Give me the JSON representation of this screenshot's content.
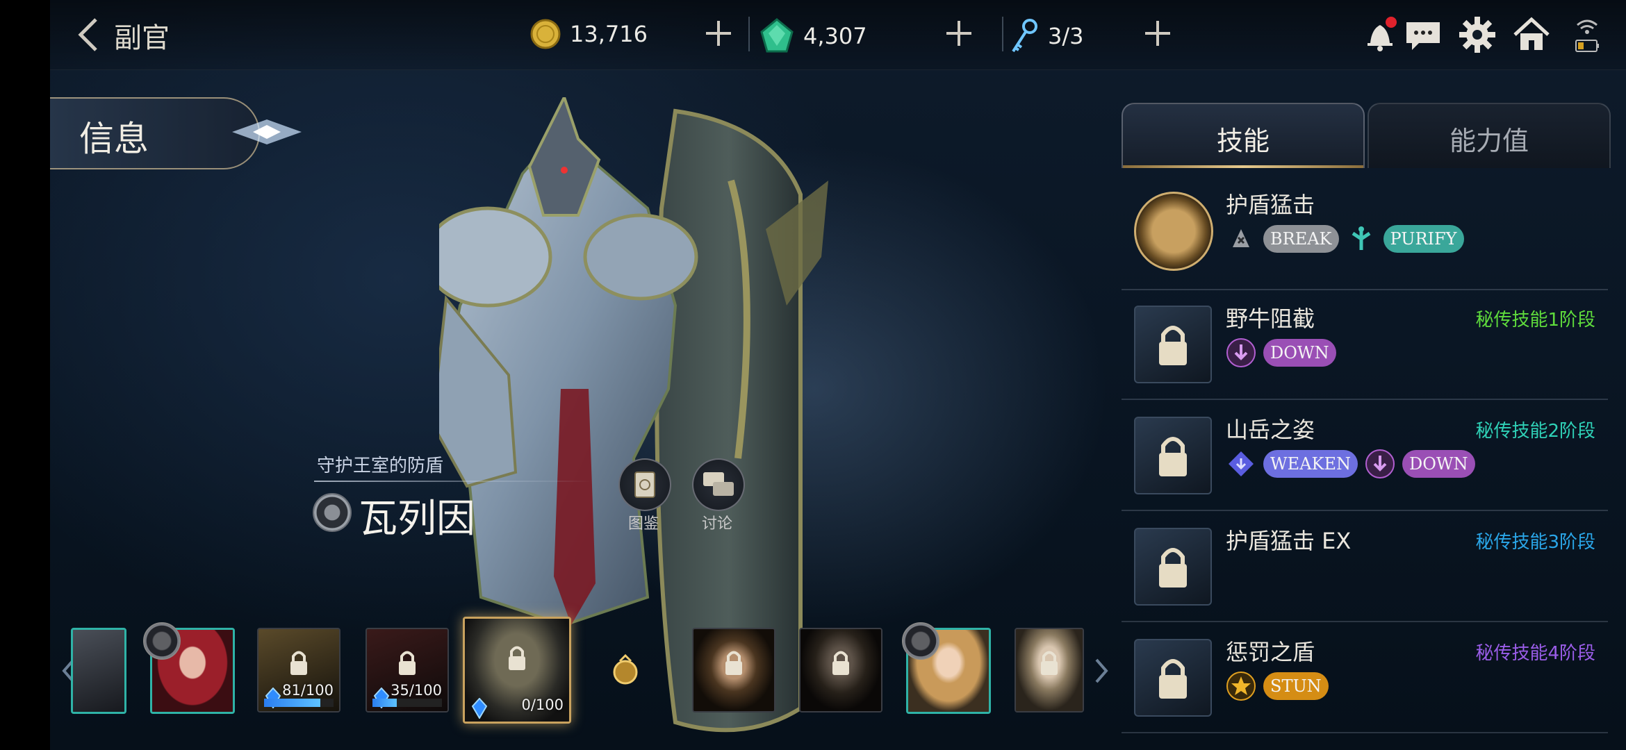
{
  "header": {
    "title": "副官",
    "gold": "13,716",
    "gems": "4,307",
    "keys": "3/3"
  },
  "info_tab": {
    "label": "信息"
  },
  "hero": {
    "subtitle": "守护王室的防盾",
    "name": "瓦列因",
    "btn_codex": "图鉴",
    "btn_discuss": "讨论"
  },
  "roster": [
    {
      "id": "c1",
      "locked": false,
      "teal": true
    },
    {
      "id": "c2",
      "locked": false,
      "teal": true,
      "badge": true
    },
    {
      "id": "c3",
      "locked": true,
      "progress": "81/100",
      "fraction": 0.81
    },
    {
      "id": "c4",
      "locked": true,
      "progress": "35/100",
      "fraction": 0.35
    },
    {
      "id": "c5",
      "locked": true,
      "progress": "0/100",
      "fraction": 0.0,
      "selected": true
    },
    {
      "id": "c6",
      "locked": true
    },
    {
      "id": "c7",
      "locked": true
    },
    {
      "id": "c8",
      "locked": false,
      "teal": true,
      "badge": true
    },
    {
      "id": "c9",
      "locked": true
    }
  ],
  "panel": {
    "tab_skill": "技能",
    "tab_stats": "能力值",
    "skills": [
      {
        "name": "护盾猛击",
        "stage": "",
        "tags": [
          {
            "icon": "break-icon",
            "label": "BREAK",
            "color": "#8e9196"
          },
          {
            "icon": "purify-icon",
            "label": "PURIFY",
            "color": "#3aa79a"
          }
        ]
      },
      {
        "name": "野牛阻截",
        "stage": "秘传技能1阶段",
        "stage_color": "#5fdc3c",
        "tags": [
          {
            "icon": "down-icon",
            "label": "DOWN",
            "color": "#9a4fb5"
          }
        ]
      },
      {
        "name": "山岳之姿",
        "stage": "秘传技能2阶段",
        "stage_color": "#2fd1b7",
        "tags": [
          {
            "icon": "weaken-icon",
            "label": "WEAKEN",
            "color": "#6d6fe0"
          },
          {
            "icon": "down-icon",
            "label": "DOWN",
            "color": "#9a4fb5"
          }
        ]
      },
      {
        "name": "护盾猛击 EX",
        "stage": "秘传技能3阶段",
        "stage_color": "#2aa6e8",
        "tags": []
      },
      {
        "name": "惩罚之盾",
        "stage": "秘传技能4阶段",
        "stage_color": "#9a5de8",
        "tags": [
          {
            "icon": "stun-icon",
            "label": "STUN",
            "color": "#d58d14"
          }
        ]
      }
    ]
  }
}
